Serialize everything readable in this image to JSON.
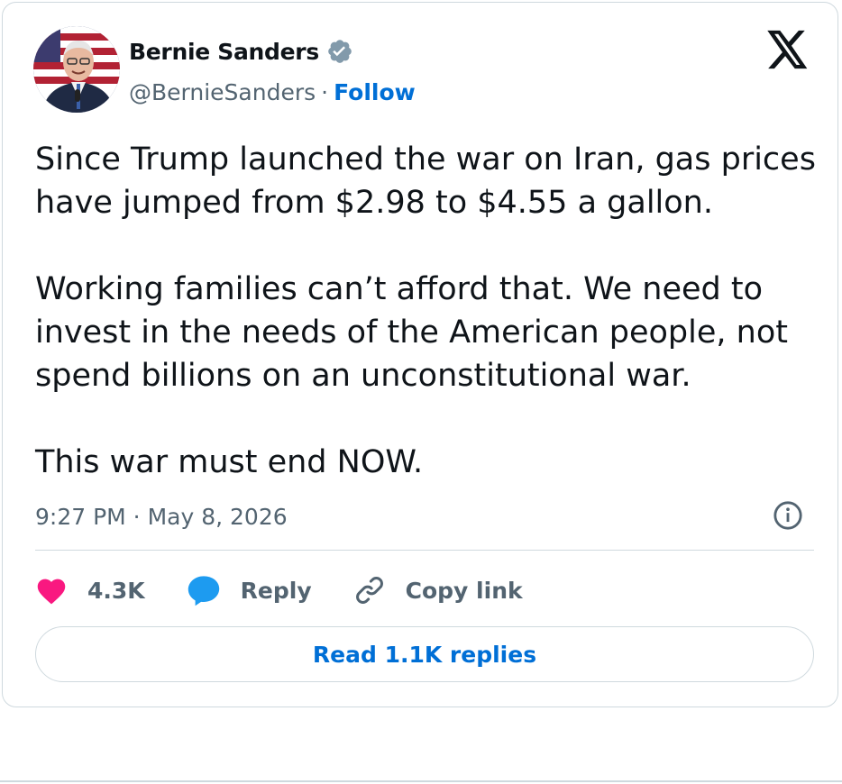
{
  "author": {
    "name": "Bernie Sanders",
    "handle": "@BernieSanders",
    "separator": "·",
    "follow_label": "Follow",
    "verified": true
  },
  "tweet": {
    "paragraphs": [
      "Since Trump launched the war on Iran, gas prices have jumped from $2.98 to $4.55 a gallon.",
      "Working families can’t afford that. We need to invest in the needs of the American people, not spend billions on an unconstitutional war.",
      "This war must end NOW."
    ],
    "timestamp": "9:27 PM · May 8, 2026"
  },
  "actions": {
    "like_count": "4.3K",
    "reply_label": "Reply",
    "copy_link_label": "Copy link"
  },
  "replies_button": {
    "label": "Read 1.1K replies"
  },
  "icons": {
    "platform_logo": "x-logo-icon",
    "verified": "verified-badge-icon",
    "info": "info-icon",
    "like": "heart-icon",
    "reply": "speech-bubble-icon",
    "copy_link": "link-icon"
  },
  "colors": {
    "accent": "#006fd6",
    "verified_badge": "#829aab",
    "like": "#f91880",
    "reply_bubble": "#1d9bf0",
    "secondary_text": "#536471",
    "border": "#cfd9de"
  }
}
